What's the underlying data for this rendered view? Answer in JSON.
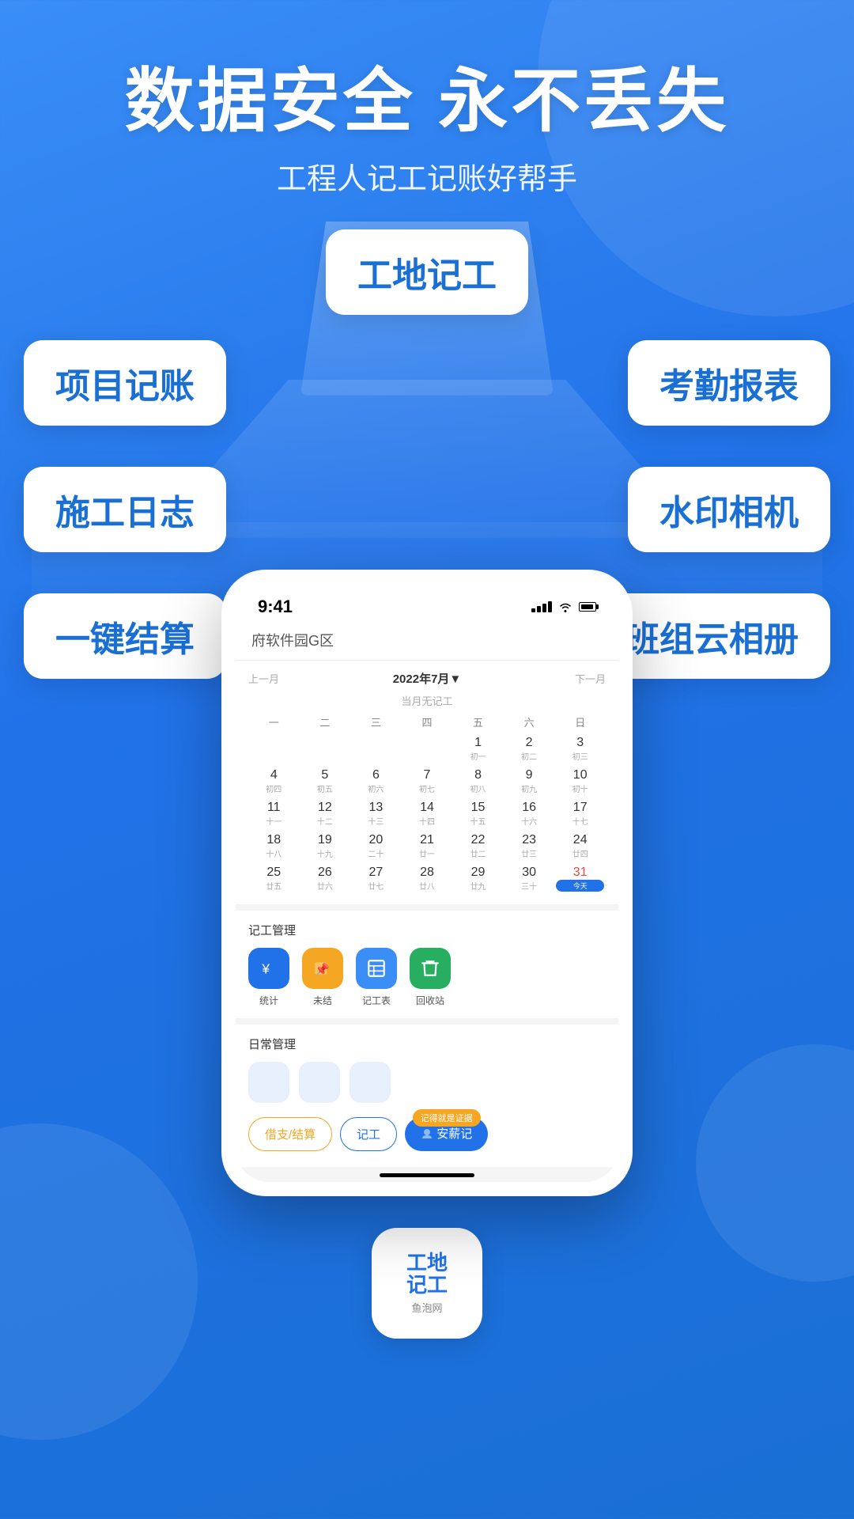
{
  "background": {
    "gradient_start": "#3a8ef6",
    "gradient_end": "#1a6fd4"
  },
  "header": {
    "title": "数据安全 永不丢失",
    "subtitle": "工程人记工记账好帮手"
  },
  "features": {
    "center_top": "工地记工",
    "left_1": "项目记账",
    "right_1": "考勤报表",
    "left_2": "施工日志",
    "right_2": "水印相机",
    "left_3": "一键结算",
    "right_3": "班组云相册"
  },
  "phone": {
    "status_bar": {
      "time": "9:41",
      "signal": "..ll",
      "wifi": "WiFi",
      "battery": "100%"
    },
    "location": "府软件园G区",
    "calendar": {
      "prev_label": "上一月",
      "next_label": "下一月",
      "year_month": "2022年7月▼",
      "no_record": "当月无记工",
      "weekdays": [
        "一",
        "二",
        "三",
        "四",
        "五",
        "六",
        "日"
      ],
      "days": [
        {
          "num": "",
          "lunar": "",
          "empty": true
        },
        {
          "num": "",
          "lunar": "",
          "empty": true
        },
        {
          "num": "",
          "lunar": "",
          "empty": true
        },
        {
          "num": "",
          "lunar": "",
          "empty": true
        },
        {
          "num": "1",
          "lunar": "初一"
        },
        {
          "num": "2",
          "lunar": "初二"
        },
        {
          "num": "3",
          "lunar": "初三"
        },
        {
          "num": "4",
          "lunar": "初四"
        },
        {
          "num": "5",
          "lunar": "初五"
        },
        {
          "num": "6",
          "lunar": "初六"
        },
        {
          "num": "7",
          "lunar": "初七"
        },
        {
          "num": "8",
          "lunar": "初八"
        },
        {
          "num": "9",
          "lunar": "初九"
        },
        {
          "num": "10",
          "lunar": "初十"
        },
        {
          "num": "11",
          "lunar": "十一"
        },
        {
          "num": "12",
          "lunar": "十二"
        },
        {
          "num": "13",
          "lunar": "十三"
        },
        {
          "num": "14",
          "lunar": "十四"
        },
        {
          "num": "15",
          "lunar": "十五"
        },
        {
          "num": "16",
          "lunar": "十六"
        },
        {
          "num": "17",
          "lunar": "十七"
        },
        {
          "num": "18",
          "lunar": "十八"
        },
        {
          "num": "19",
          "lunar": "十九"
        },
        {
          "num": "20",
          "lunar": "二十"
        },
        {
          "num": "21",
          "lunar": "廿一"
        },
        {
          "num": "22",
          "lunar": "廿二"
        },
        {
          "num": "23",
          "lunar": "廿三"
        },
        {
          "num": "24",
          "lunar": "廿四"
        },
        {
          "num": "25",
          "lunar": "廿五"
        },
        {
          "num": "26",
          "lunar": "廿六"
        },
        {
          "num": "27",
          "lunar": "廿七"
        },
        {
          "num": "28",
          "lunar": "廿八"
        },
        {
          "num": "29",
          "lunar": "廿九"
        },
        {
          "num": "30",
          "lunar": "三十"
        },
        {
          "num": "31",
          "lunar": "今天",
          "today": true
        }
      ]
    },
    "work_management": {
      "title": "记工管理",
      "items": [
        {
          "label": "统计",
          "icon": "¥",
          "color": "blue"
        },
        {
          "label": "未结",
          "icon": "🔖",
          "color": "orange"
        },
        {
          "label": "记工表",
          "icon": "📋",
          "color": "blue2"
        },
        {
          "label": "回收站",
          "icon": "🗑",
          "color": "green"
        }
      ]
    },
    "daily_management": {
      "title": "日常管理"
    },
    "action_bar": {
      "btn1_label": "借支/结算",
      "btn2_label": "记工",
      "btn3_label": "安薪记",
      "btn3_badge": "记得就是证据"
    }
  },
  "app_icon": {
    "line1": "工地",
    "line2": "记工",
    "sub": "鱼泡网"
  }
}
